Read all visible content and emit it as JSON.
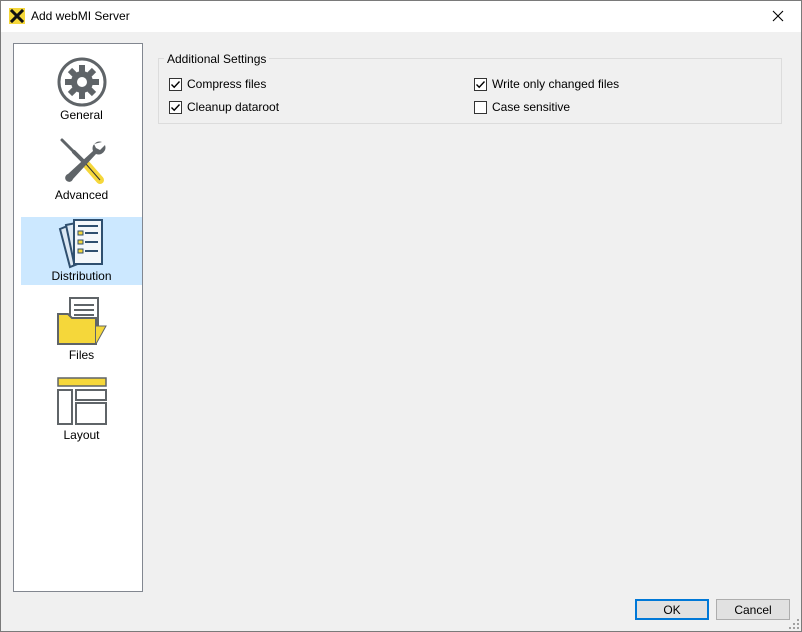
{
  "window": {
    "title": "Add webMI Server"
  },
  "nav": {
    "items": [
      {
        "label": "General",
        "icon": "gear-icon"
      },
      {
        "label": "Advanced",
        "icon": "tools-icon"
      },
      {
        "label": "Distribution",
        "icon": "documents-icon",
        "selected": true
      },
      {
        "label": "Files",
        "icon": "folder-icon"
      },
      {
        "label": "Layout",
        "icon": "layout-icon"
      }
    ]
  },
  "settings": {
    "group_title": "Additional Settings",
    "options": [
      {
        "label": "Compress files",
        "checked": true
      },
      {
        "label": "Write only changed files",
        "checked": true
      },
      {
        "label": "Cleanup dataroot",
        "checked": true
      },
      {
        "label": "Case sensitive",
        "checked": false
      }
    ]
  },
  "buttons": {
    "ok": "OK",
    "cancel": "Cancel"
  },
  "colors": {
    "selection": "#cce8ff",
    "accent_yellow": "#f5d73a",
    "icon_gray": "#5f6468",
    "default_button_border": "#0078d7"
  }
}
